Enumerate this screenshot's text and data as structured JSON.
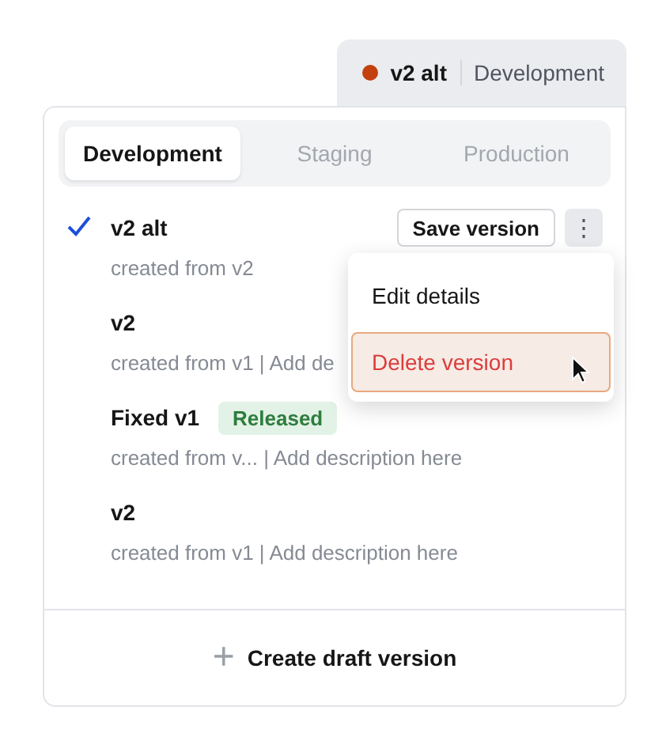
{
  "current": {
    "color": "#c2410c",
    "name": "v2 alt",
    "environment": "Development"
  },
  "tabs": [
    {
      "label": "Development",
      "selected": true
    },
    {
      "label": "Staging",
      "selected": false
    },
    {
      "label": "Production",
      "selected": false
    }
  ],
  "versions": [
    {
      "name": "v2 alt",
      "selected": true,
      "description": "created from v2",
      "save_button": "Save version",
      "more_button": "⋮"
    },
    {
      "name": "v2",
      "selected": false,
      "description": "created from v1 | Add de"
    },
    {
      "name": "Fixed v1",
      "selected": false,
      "badge": "Released",
      "description": "created from v... | Add description here"
    },
    {
      "name": "v2",
      "selected": false,
      "description": "created from v1 | Add description here"
    }
  ],
  "menu": {
    "items": [
      {
        "label": "Edit details",
        "kind": "normal",
        "hovered": false
      },
      {
        "label": "Delete version",
        "kind": "danger",
        "hovered": true
      }
    ]
  },
  "create_button": {
    "icon": "+",
    "label": "Create draft version"
  }
}
